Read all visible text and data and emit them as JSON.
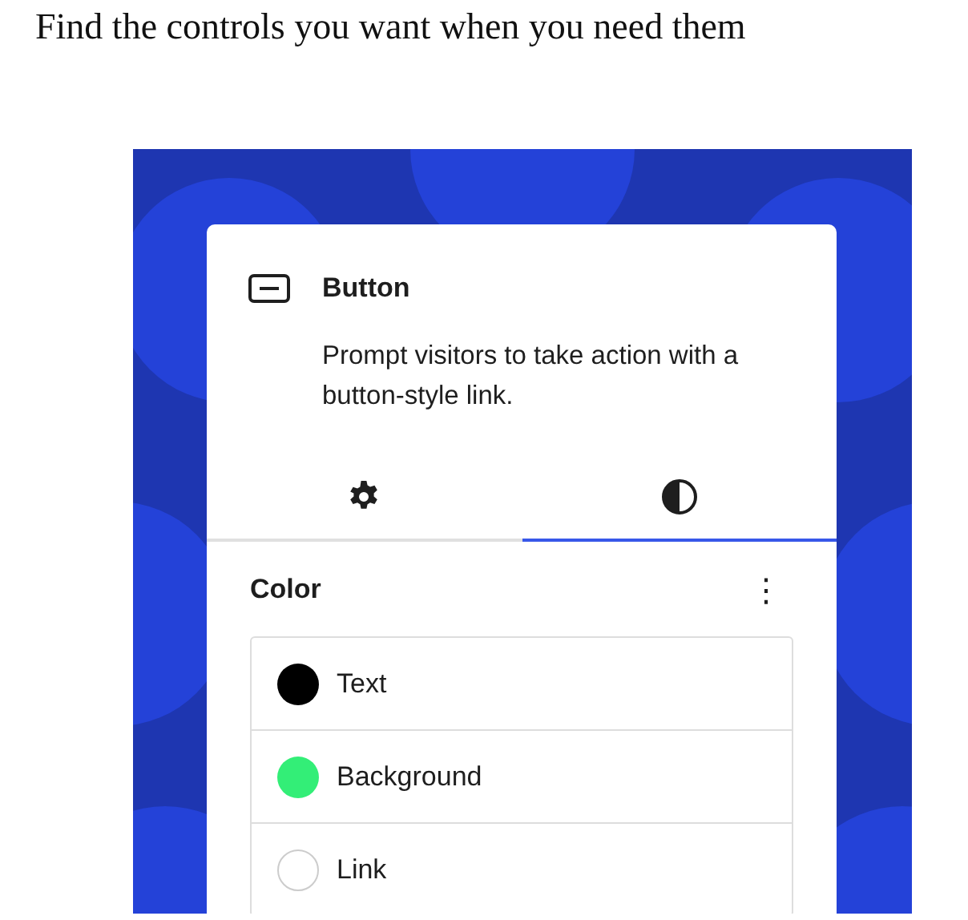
{
  "heading": "Find the controls you want when you need them",
  "panel": {
    "block": {
      "title": "Button",
      "description": "Prompt visitors to take action with a button-style link."
    },
    "tabs": [
      {
        "kind": "settings",
        "selected": false
      },
      {
        "kind": "styles",
        "selected": true
      }
    ],
    "section": {
      "title": "Color",
      "menu": "⋮"
    },
    "colors": [
      {
        "label": "Text",
        "color": "#000000"
      },
      {
        "label": "Background",
        "color": "#33ee77"
      },
      {
        "label": "Link"
      }
    ]
  }
}
